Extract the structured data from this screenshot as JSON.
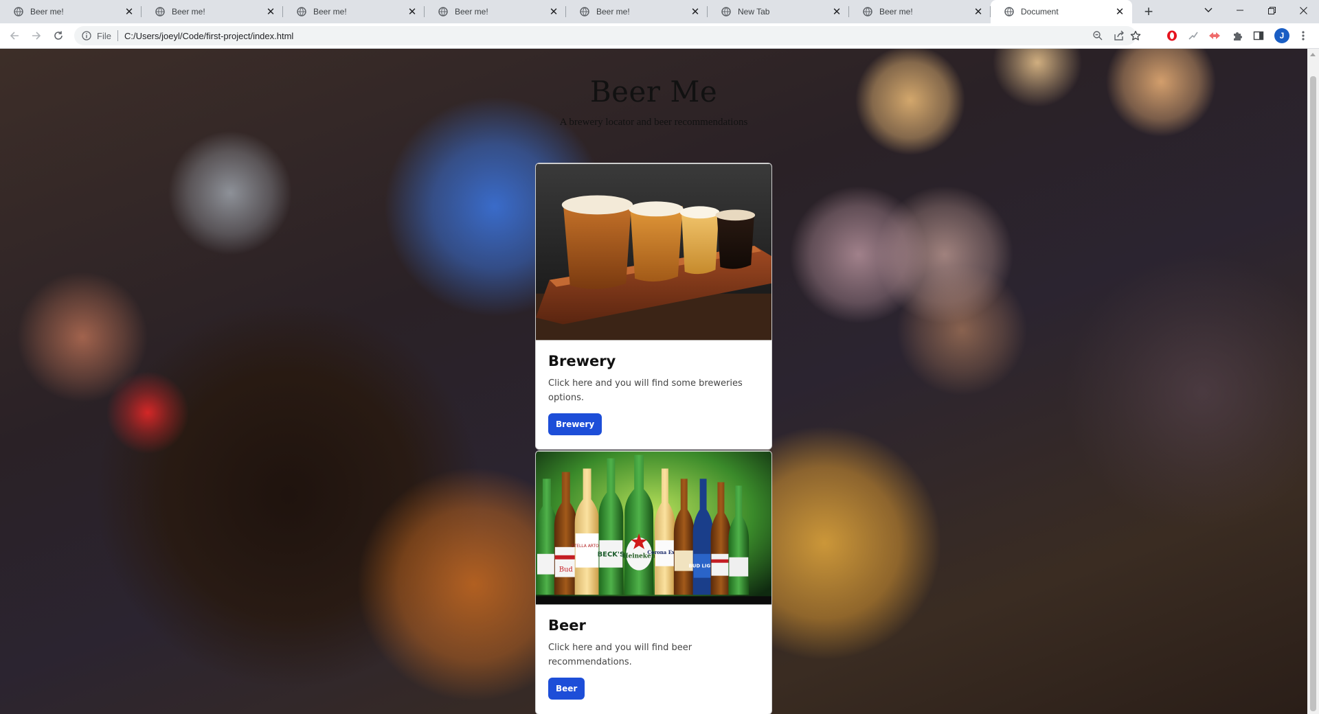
{
  "browser": {
    "tabs": [
      {
        "title": "Beer me!",
        "active": false
      },
      {
        "title": "Beer me!",
        "active": false
      },
      {
        "title": "Beer me!",
        "active": false
      },
      {
        "title": "Beer me!",
        "active": false
      },
      {
        "title": "Beer me!",
        "active": false
      },
      {
        "title": "New Tab",
        "active": false
      },
      {
        "title": "Beer me!",
        "active": false
      },
      {
        "title": "Document",
        "active": true
      }
    ],
    "address": {
      "scheme_label": "File",
      "url": "C:/Users/joeyl/Code/first-project/index.html"
    },
    "profile_initial": "J"
  },
  "page": {
    "title": "Beer Me",
    "subtitle": "A brewery locator and beer recommendations",
    "cards": [
      {
        "heading": "Brewery",
        "text": "Click here and you will find some breweries options.",
        "button_label": "Brewery"
      },
      {
        "heading": "Beer",
        "text": "Click here and you will find beer recommendations.",
        "button_label": "Beer"
      }
    ]
  },
  "bottle_labels": [
    "Bud",
    "STELLA ARTOIS",
    "BECK'S",
    "Heineken",
    "Corona Extra",
    "BUD LIGHT"
  ],
  "colors": {
    "button_bg": "#1d4ed8",
    "avatar_bg": "#1a5ec4",
    "tabstrip_bg": "#dee1e6"
  }
}
